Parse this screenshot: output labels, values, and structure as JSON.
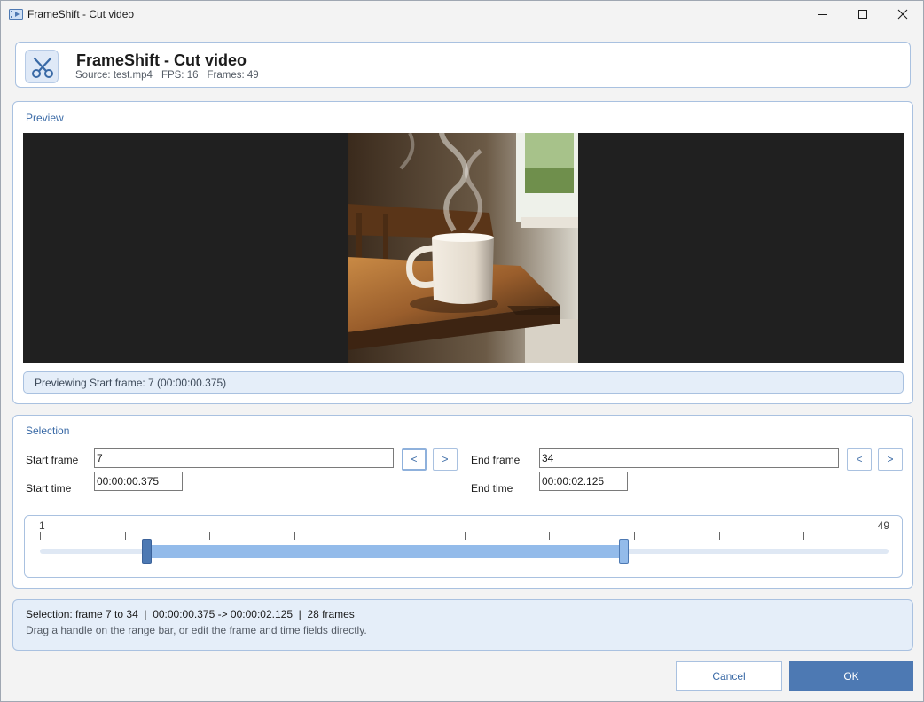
{
  "window": {
    "title": "FrameShift - Cut video",
    "minimize_icon": "minimize-icon",
    "maximize_icon": "maximize-icon",
    "close_icon": "close-icon"
  },
  "header": {
    "title": "FrameShift - Cut video",
    "source": "Source: test.mp4",
    "fps": "FPS: 16",
    "frames": "Frames: 49",
    "icon": "scissors-icon"
  },
  "preview": {
    "label": "Preview",
    "status": "Previewing Start frame: 7 (00:00:00.375)"
  },
  "selection": {
    "label": "Selection",
    "start_frame_label": "Start frame",
    "start_frame_value": "7",
    "start_time_label": "Start time",
    "start_time_value": "00:00:00.375",
    "end_frame_label": "End frame",
    "end_frame_value": "34",
    "end_time_label": "End time",
    "end_time_value": "00:00:02.125",
    "prev_label": "<",
    "next_label": ">"
  },
  "range": {
    "min_label": "1",
    "max_label": "49",
    "min": 1,
    "max": 49,
    "start": 7,
    "end": 34,
    "tick_count": 11
  },
  "info": {
    "summary": "Selection: frame 7 to 34  |  00:00:00.375 -> 00:00:02.125  |  28 frames",
    "hint": "Drag a handle on the range bar, or edit the frame and time fields directly."
  },
  "buttons": {
    "cancel": "Cancel",
    "ok": "OK"
  },
  "colors": {
    "accent": "#4d79b3",
    "accent_light": "#93bbea",
    "panel_border": "#a9c1e0",
    "label_blue": "#3a6aa6"
  }
}
